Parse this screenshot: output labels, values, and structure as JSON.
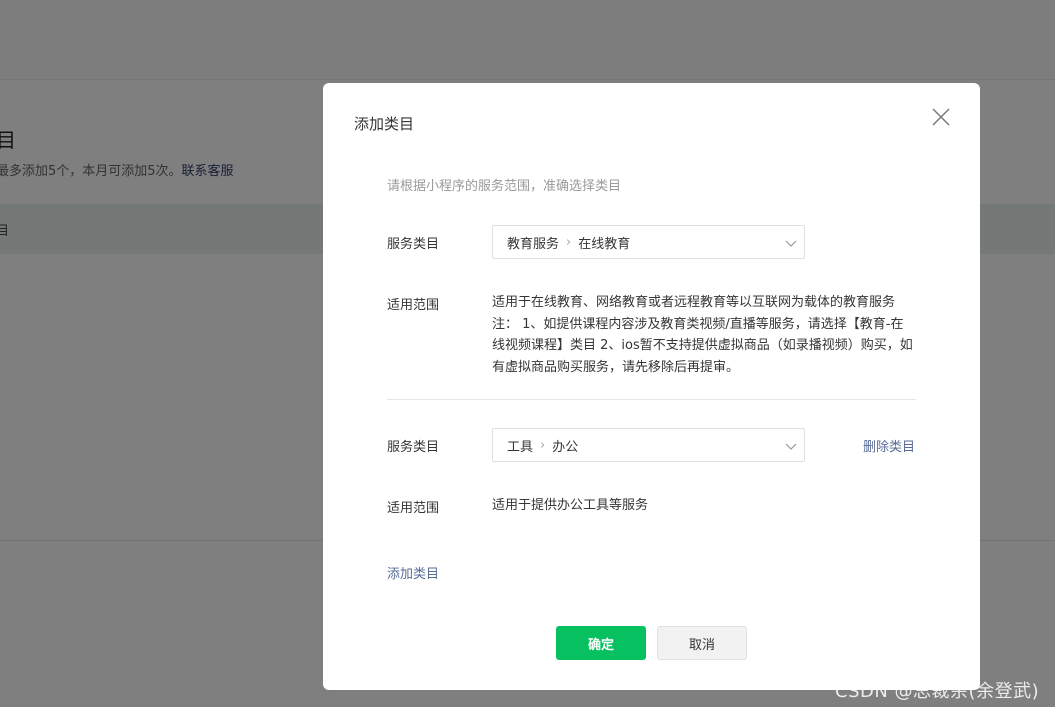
{
  "background": {
    "title": "目",
    "desc": "最多添加5个，本月可添加5次。",
    "desc_link": "联系客服",
    "band_text": "目"
  },
  "dialog": {
    "title": "添加类目",
    "hint": "请根据小程序的服务范围，准确选择类目",
    "categories": [
      {
        "label": "服务类目",
        "path": [
          "教育服务",
          "在线教育"
        ],
        "scope_label": "适用范围",
        "scope_lines": [
          "适用于在线教育、网络教育或者远程教育等以互联网为载体的教育服务",
          "注： 1、如提供课程内容涉及教育类视频/直播等服务，请选择【教育-在",
          "线视频课程】类目 2、ios暂不支持提供虚拟商品（如录播视频）购买，如",
          "有虚拟商品购买服务，请先移除后再提审。"
        ]
      },
      {
        "label": "服务类目",
        "path": [
          "工具",
          "办公"
        ],
        "delete_label": "删除类目",
        "scope_label": "适用范围",
        "scope_lines": [
          "适用于提供办公工具等服务"
        ]
      }
    ],
    "add_category": "添加类目",
    "confirm": "确定",
    "cancel": "取消"
  },
  "watermark": "CSDN @总裁余(余登武)",
  "colors": {
    "primary": "#07c160",
    "link": "#576b95"
  }
}
